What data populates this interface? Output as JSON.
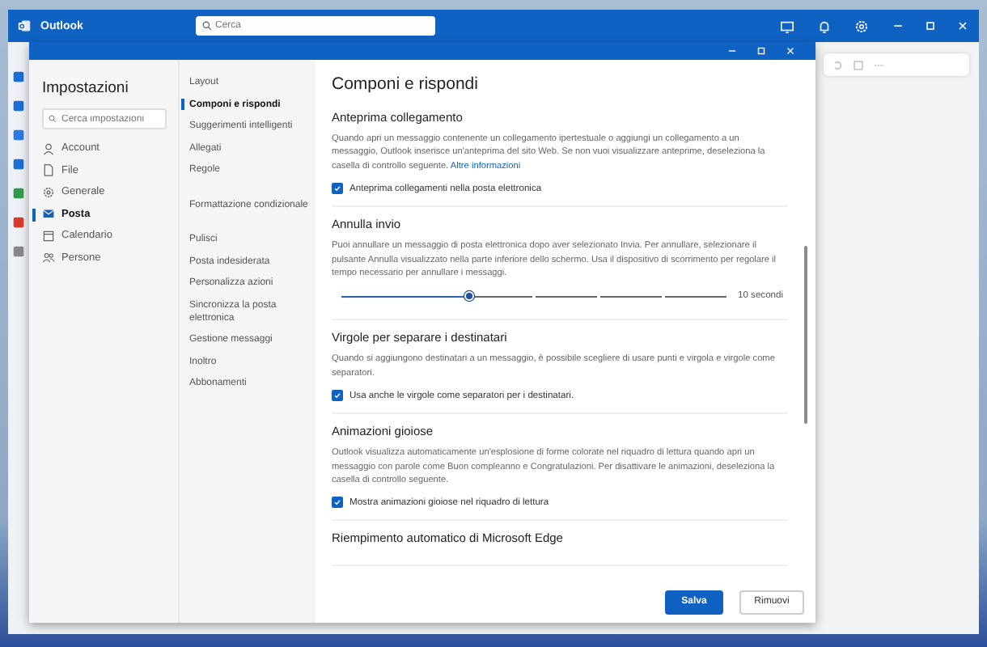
{
  "outlook": {
    "app_name": "Outlook",
    "search": {
      "placeholder": "Cerca"
    }
  },
  "settings": {
    "title": "Impostazioni",
    "search": {
      "placeholder": "Cerca impostazioni"
    },
    "categories": [
      {
        "label": "Account",
        "selected": false
      },
      {
        "label": "File",
        "selected": false
      },
      {
        "label": "Generale",
        "selected": false
      },
      {
        "label": "Posta",
        "selected": true
      },
      {
        "label": "Calendario",
        "selected": false
      },
      {
        "label": "Persone",
        "selected": false
      }
    ],
    "subcategory_groups": [
      {
        "items": [
          {
            "label": "Layout",
            "selected": false
          },
          {
            "label": "Componi e rispondi",
            "selected": true
          },
          {
            "label": "Suggerimenti intelligenti",
            "selected": false
          },
          {
            "label": "Allegati",
            "selected": false
          },
          {
            "label": "Regole",
            "selected": false
          }
        ]
      },
      {
        "items": [
          {
            "label": "Formattazione condizionale",
            "selected": false
          }
        ]
      },
      {
        "items": [
          {
            "label": "Pulisci",
            "selected": false
          },
          {
            "label": "Posta indesiderata",
            "selected": false
          },
          {
            "label": "Personalizza azioni",
            "selected": false
          },
          {
            "label": "Sincronizza la posta elettronica",
            "selected": false
          },
          {
            "label": "Gestione messaggi",
            "selected": false
          },
          {
            "label": "Inoltro",
            "selected": false
          },
          {
            "label": "Abbonamenti",
            "selected": false
          }
        ]
      }
    ]
  },
  "panel": {
    "title": "Componi e rispondi",
    "sections": [
      {
        "kind": "checkbox",
        "heading": "Anteprima collegamento",
        "description": "Quando apri un messaggio contenente un collegamento ipertestuale o aggiungi un collegamento a un messaggio, Outlook inserisce un'anteprima del sito Web. Se non vuoi visualizzare anteprime, deseleziona la casella di controllo seguente.",
        "link": "Altre informazioni",
        "checkbox": {
          "label": "Anteprima collegamenti nella posta elettronica",
          "checked": true
        }
      },
      {
        "kind": "slider",
        "heading": "Annulla invio",
        "description": "Puoi annullare un messaggio di posta elettronica dopo aver selezionato Invia. Per annullare, selezionare il pulsante Annulla visualizzato nella parte inferiore dello schermo. Usa il dispositivo di scorrimento per regolare il tempo necessario per annullare i messaggi.",
        "slider": {
          "level": 0.33,
          "reading": "10 secondi"
        }
      },
      {
        "kind": "checkbox",
        "heading": "Virgole per separare i destinatari",
        "description": "Quando si aggiungono destinatari a un messaggio, è possibile scegliere di usare punti e virgola e virgole come separatori.",
        "checkbox": {
          "label": "Usa anche le virgole come separatori per i destinatari.",
          "checked": true
        }
      },
      {
        "kind": "checkbox",
        "heading": "Animazioni gioiose",
        "description": "Outlook visualizza automaticamente un'esplosione di forme colorate nel riquadro di lettura quando apri un messaggio con parole come Buon compleanno e Congratulazioni. Per disattivare le animazioni, deseleziona la casella di controllo seguente.",
        "checkbox": {
          "label": "Mostra animazioni gioiose nel riquadro di lettura",
          "checked": true
        }
      },
      {
        "kind": "heading",
        "heading": "Riempimento automatico di Microsoft Edge"
      }
    ]
  },
  "buttons": [
    {
      "label": "Salva",
      "kind": "primary"
    },
    {
      "label": "Rimuovi",
      "kind": "secondary"
    }
  ]
}
